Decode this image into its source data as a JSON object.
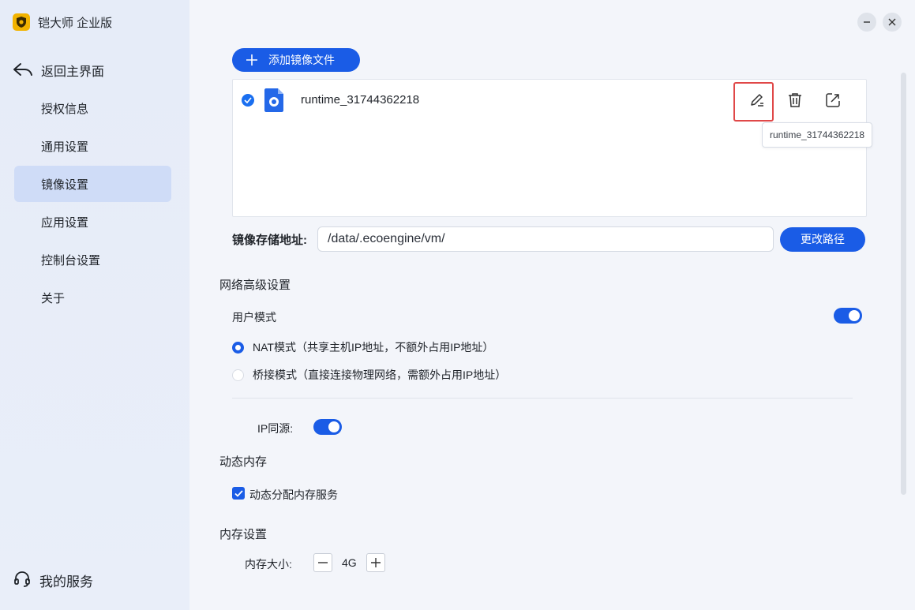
{
  "app": {
    "title": "铠大师 企业版"
  },
  "sidebar": {
    "back_label": "返回主界面",
    "items": [
      {
        "label": "授权信息",
        "active": false
      },
      {
        "label": "通用设置",
        "active": false
      },
      {
        "label": "镜像设置",
        "active": true
      },
      {
        "label": "应用设置",
        "active": false
      },
      {
        "label": "控制台设置",
        "active": false
      },
      {
        "label": "关于",
        "active": false
      }
    ],
    "service_label": "我的服务"
  },
  "main": {
    "add_image_label": "添加镜像文件",
    "images": [
      {
        "name": "runtime_31744362218",
        "selected": true
      }
    ],
    "tooltip": "runtime_31744362218",
    "storage": {
      "label": "镜像存储地址:",
      "value": "/data/.ecoengine/vm/",
      "button": "更改路径"
    },
    "network": {
      "title": "网络高级设置",
      "user_mode_label": "用户模式",
      "user_mode_on": true,
      "nat_label": "NAT模式（共享主机IP地址，不额外占用IP地址）",
      "bridge_label": "桥接模式（直接连接物理网络，需额外占用IP地址）",
      "selected_mode": "nat",
      "ip_same_label": "IP同源:",
      "ip_same_on": true
    },
    "dynamic_memory": {
      "title": "动态内存",
      "service_label": "动态分配内存服务",
      "checked": true
    },
    "memory": {
      "title": "内存设置",
      "size_label": "内存大小:",
      "size_value": "4G"
    }
  },
  "colors": {
    "accent": "#1a5ce6",
    "highlight": "#e04848",
    "active_nav": "#cfdcf7"
  }
}
